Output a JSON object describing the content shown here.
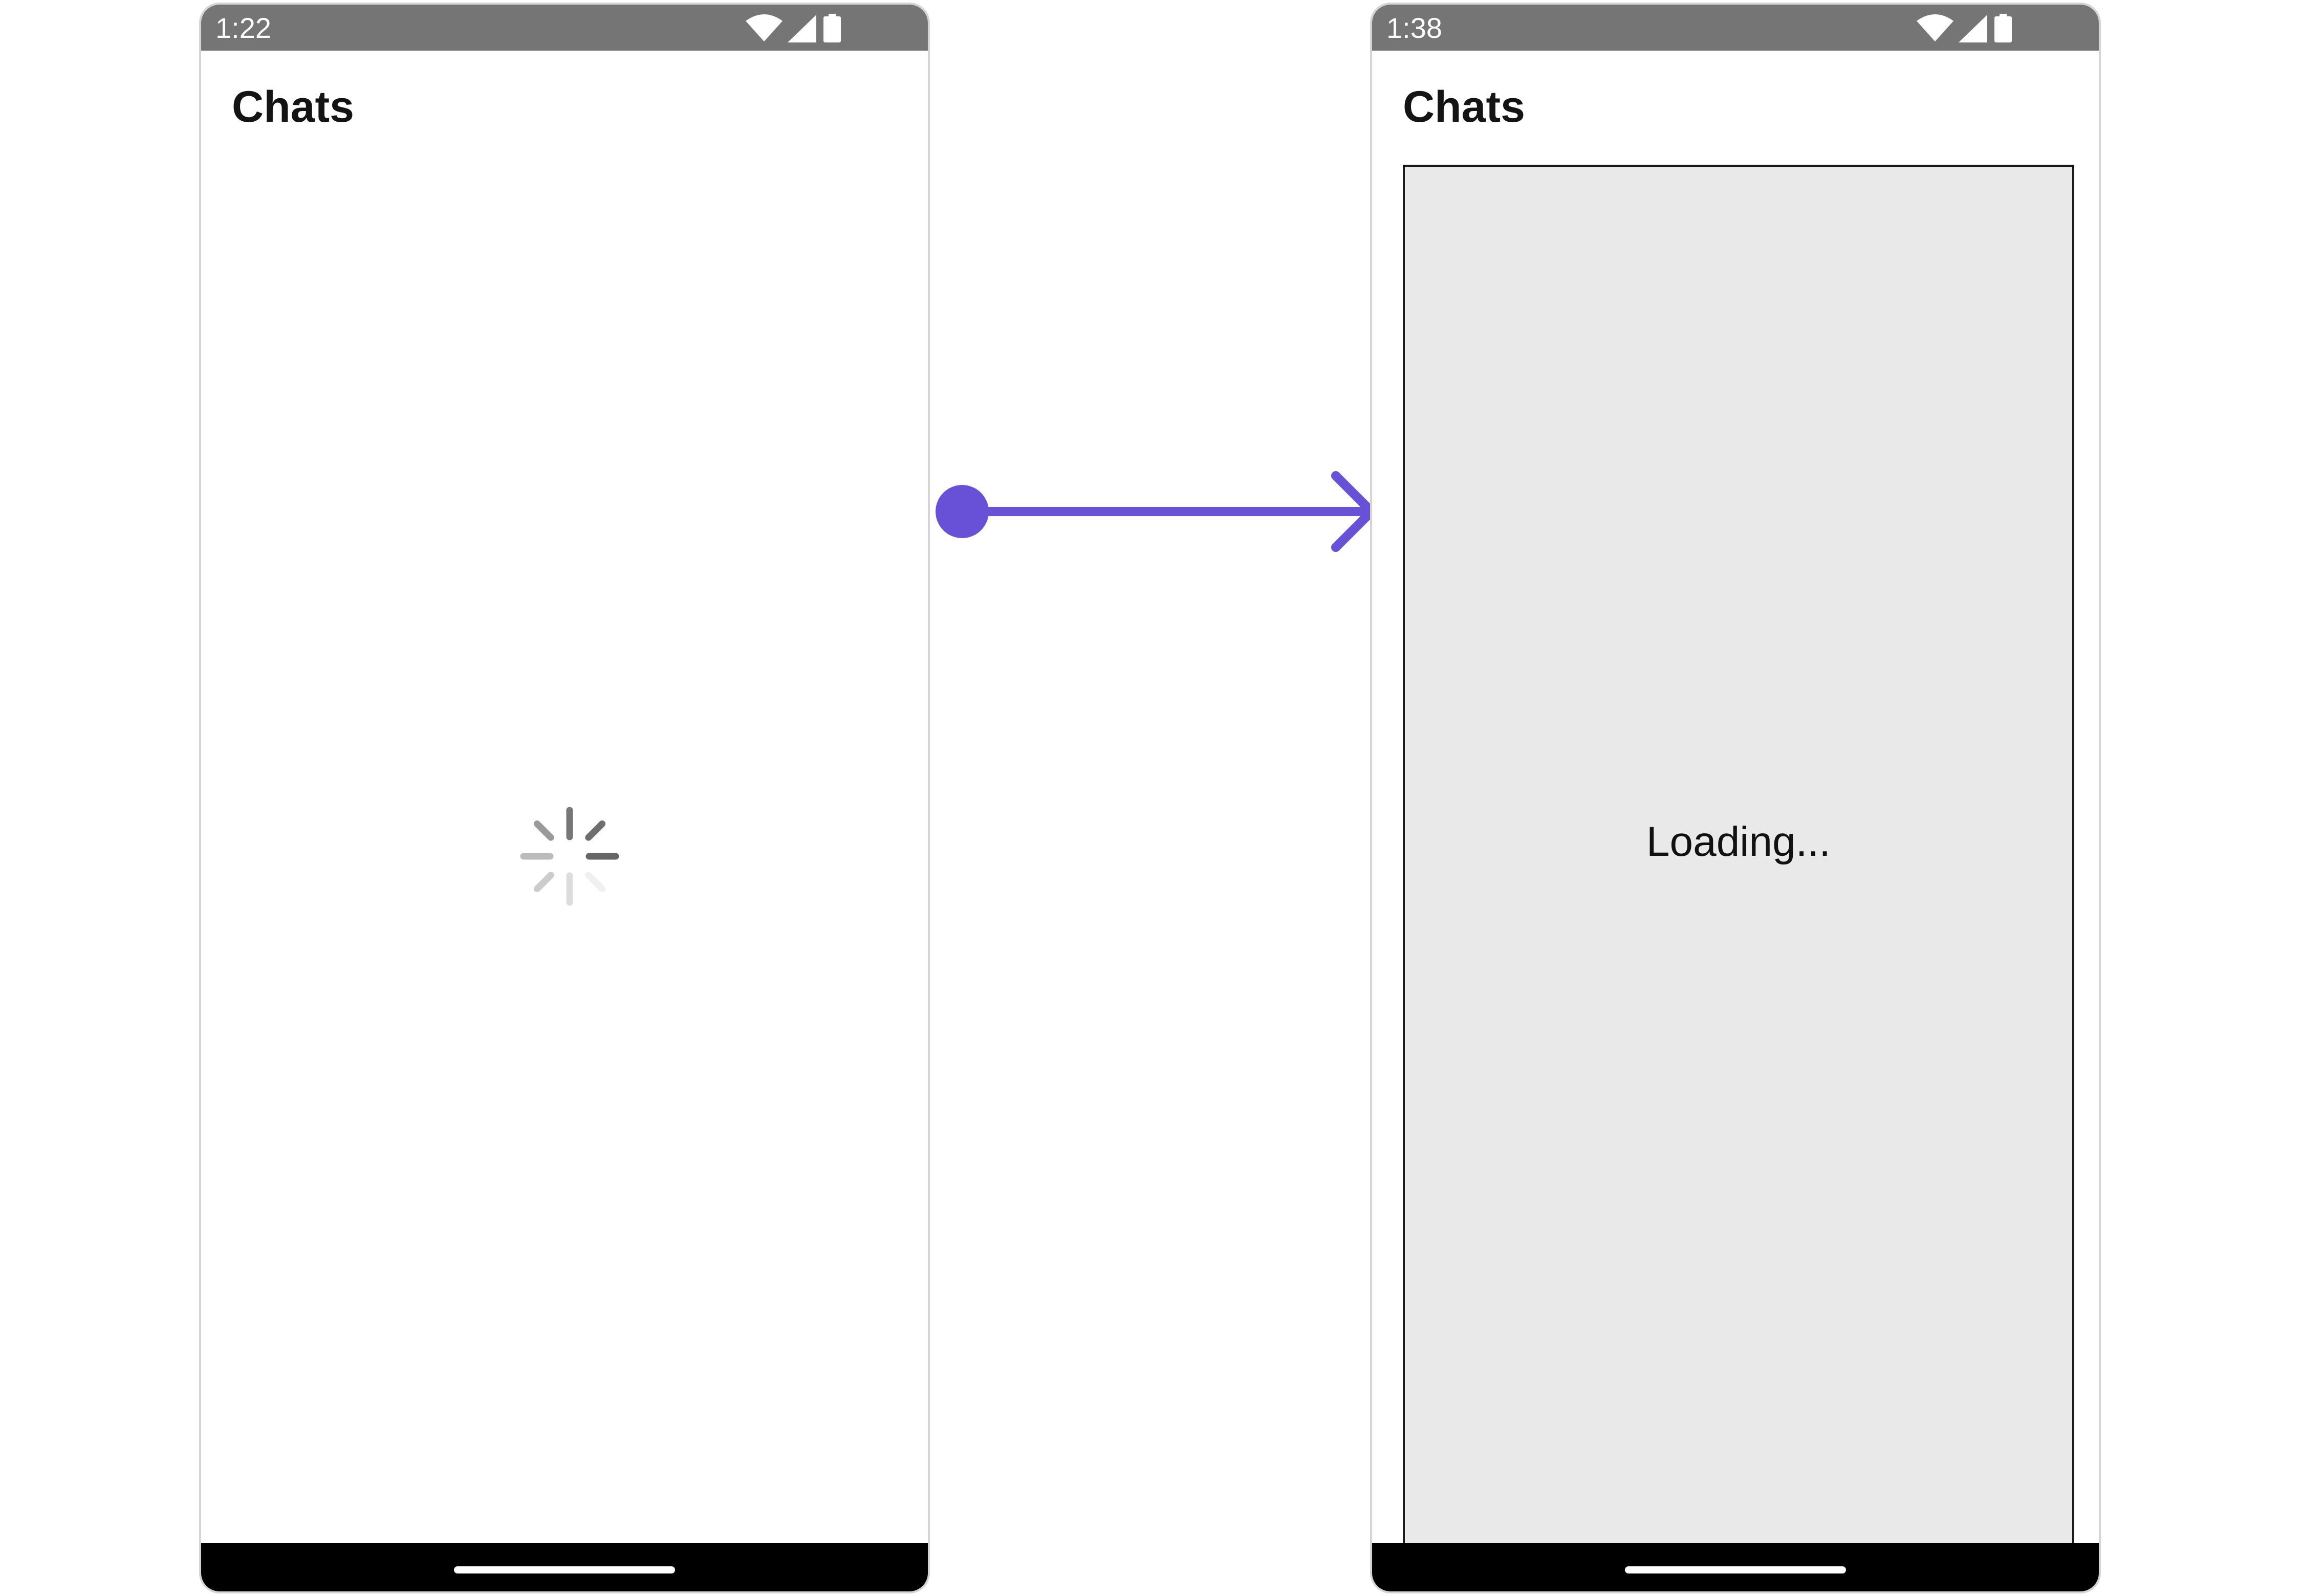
{
  "screens": [
    {
      "status_bar": {
        "time": "1:22",
        "icons": [
          "wifi-icon",
          "cellular-signal-icon",
          "battery-icon"
        ]
      },
      "title": "Chats",
      "content": "loading-spinner"
    },
    {
      "status_bar": {
        "time": "1:38",
        "icons": [
          "wifi-icon",
          "cellular-signal-icon",
          "battery-icon"
        ]
      },
      "title": "Chats",
      "loading_text": "Loading..."
    }
  ],
  "transition": {
    "icon": "arrow-right-icon"
  },
  "colors": {
    "status_bar": "#757575",
    "nav_bar": "#000000",
    "arrow_accent": "#6851d6",
    "loading_panel_bg": "#e8e9e8",
    "title_text": "#141414"
  }
}
